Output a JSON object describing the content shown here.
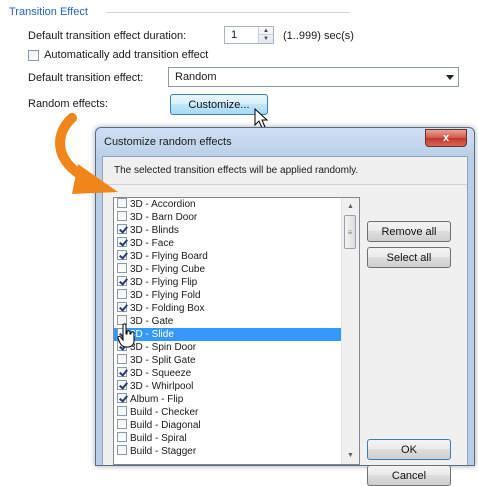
{
  "section": {
    "title": "Transition Effect"
  },
  "duration": {
    "label": "Default transition effect duration:",
    "value": "1",
    "range_text": "(1..999) sec(s)"
  },
  "auto_add": {
    "label": "Automatically add transition effect",
    "checked": false
  },
  "default_effect": {
    "label": "Default transition effect:",
    "value": "Random"
  },
  "random_effects": {
    "label": "Random effects:",
    "button_label": "Customize..."
  },
  "dialog": {
    "title": "Customize random effects",
    "close_label": "x",
    "description": "The selected transition effects will be applied randomly.",
    "items": [
      {
        "label": "3D - Accordion",
        "checked": false
      },
      {
        "label": "3D - Barn Door",
        "checked": false
      },
      {
        "label": "3D - Blinds",
        "checked": true
      },
      {
        "label": "3D - Face",
        "checked": true
      },
      {
        "label": "3D - Flying Board",
        "checked": true
      },
      {
        "label": "3D - Flying Cube",
        "checked": false
      },
      {
        "label": "3D - Flying Flip",
        "checked": true
      },
      {
        "label": "3D - Flying Fold",
        "checked": false
      },
      {
        "label": "3D - Folding Box",
        "checked": true
      },
      {
        "label": "3D - Gate",
        "checked": false
      },
      {
        "label": "3D - Slide",
        "checked": true,
        "selected": true
      },
      {
        "label": "3D - Spin Door",
        "checked": true
      },
      {
        "label": "3D - Split Gate",
        "checked": false
      },
      {
        "label": "3D - Squeeze",
        "checked": true
      },
      {
        "label": "3D - Whirlpool",
        "checked": true
      },
      {
        "label": "Album - Flip",
        "checked": true
      },
      {
        "label": "Build - Checker",
        "checked": false
      },
      {
        "label": "Build - Diagonal",
        "checked": false
      },
      {
        "label": "Build - Spiral",
        "checked": false
      },
      {
        "label": "Build - Stagger",
        "checked": false
      }
    ],
    "buttons": {
      "remove_all": "Remove all",
      "select_all": "Select all",
      "ok": "OK",
      "cancel": "Cancel"
    }
  },
  "colors": {
    "accent": "#2a62b8",
    "selection": "#3399ff",
    "arrow": "#f0861a"
  }
}
